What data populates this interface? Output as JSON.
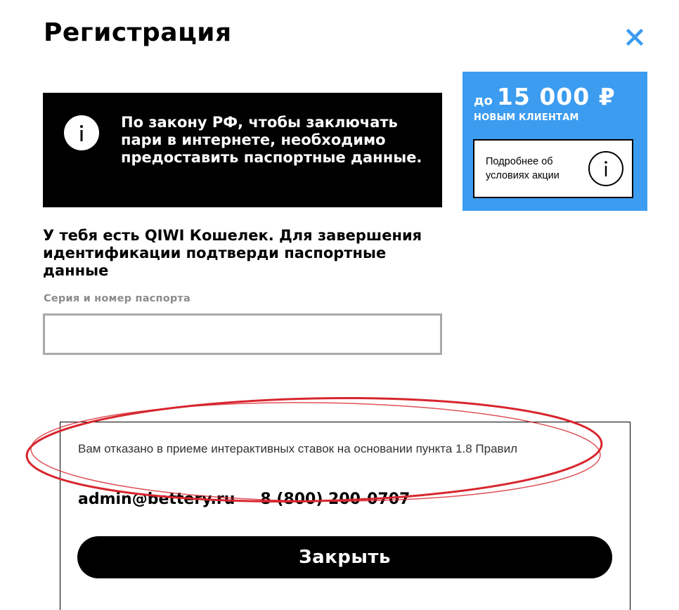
{
  "dialog": {
    "title": "Регистрация",
    "close_icon": "close-icon"
  },
  "info_box": {
    "icon": "info-icon",
    "text": "По закону РФ, чтобы заключать пари в интернете, необходимо предоставить паспортные данные."
  },
  "promo": {
    "prefix": "до",
    "amount": "15 000 ₽",
    "subtitle": "НОВЫМ КЛИЕНТАМ",
    "details_label": "Подробнее об условиях акции",
    "details_icon": "info-icon",
    "background_color": "#3b9cf0"
  },
  "form": {
    "instruction": "У тебя есть QIWI Кошелек. Для завершения идентификации подтверди паспортные данные",
    "passport_label": "Серия и номер паспорта",
    "passport_value": ""
  },
  "notice": {
    "text": "Вам отказано в приеме интерактивных ставок на основании пункта 1.8 Правил",
    "email": "admin@bettery.ru",
    "phone": "8 (800) 200-0707",
    "close_label": "Закрыть",
    "annotation_color": "#d7262e"
  }
}
